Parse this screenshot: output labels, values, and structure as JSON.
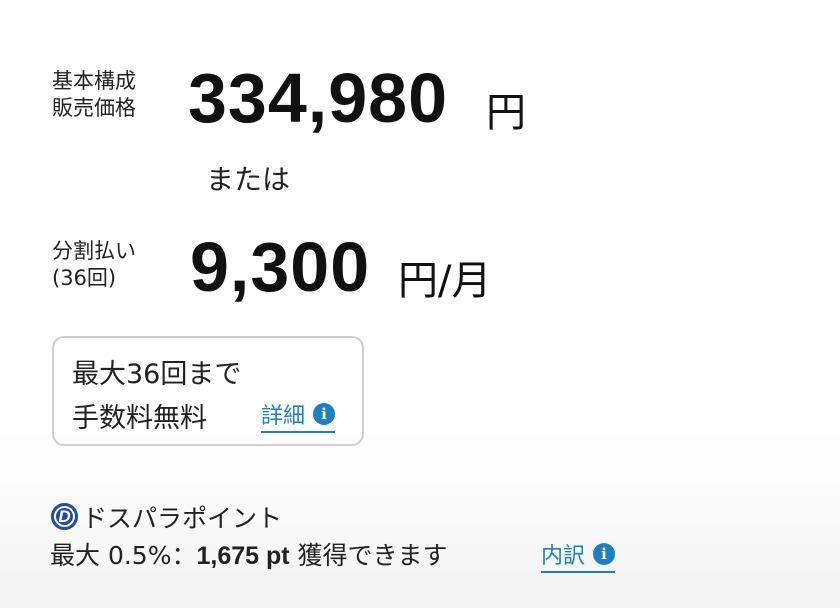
{
  "base_price": {
    "label_line1": "基本構成",
    "label_line2": "販売価格",
    "amount": "334,980",
    "unit": "円"
  },
  "separator_text": "または",
  "installment": {
    "label_line1": "分割払い",
    "label_line2": "(36回)",
    "amount": "9,300",
    "unit": "円/月"
  },
  "fee_box": {
    "line1": "最大36回まで",
    "line2": "手数料無料",
    "link_label": "詳細",
    "link_icon": "info-icon"
  },
  "points": {
    "logo_letter": "D",
    "title": "ドスパラポイント",
    "prefix": "最大 0.5%：",
    "amount": "1,675 pt",
    "suffix": " 獲得できます",
    "link_label": "内訳",
    "link_icon": "info-icon"
  },
  "colors": {
    "link": "#1d7fc4",
    "logo": "#1f4aa8"
  }
}
